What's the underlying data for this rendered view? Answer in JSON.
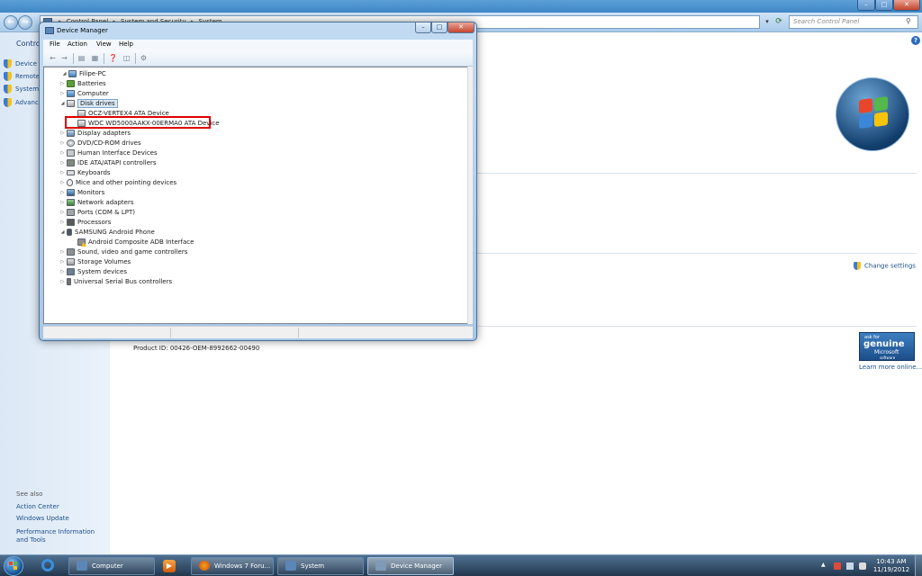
{
  "control_panel": {
    "address": {
      "crumbs": [
        "Control Panel",
        "System and Security",
        "System"
      ],
      "separator": "▸"
    },
    "search_placeholder": "Search Control Panel",
    "sidebar": {
      "header": "Control",
      "items": [
        {
          "label": "Device M"
        },
        {
          "label": "Remote"
        },
        {
          "label": "System"
        },
        {
          "label": "Advanc"
        }
      ],
      "see_also_header": "See also",
      "see_also_links": [
        {
          "label": "Action Center"
        },
        {
          "label": "Windows Update"
        },
        {
          "label": "Performance Information and Tools"
        }
      ]
    },
    "change_settings": "Change settings",
    "product_id": "Product ID: 00426-OEM-8992662-00490",
    "genuine": {
      "ask": "ask for",
      "word": "genuine",
      "microsoft": "Microsoft",
      "software": "software"
    },
    "learn_more": "Learn more online..."
  },
  "device_manager": {
    "title": "Device Manager",
    "menu": [
      "File",
      "Action",
      "View",
      "Help"
    ],
    "tree": [
      {
        "label": "Filipe-PC",
        "level": 0,
        "expanded": true,
        "icon": "computer-icon"
      },
      {
        "label": "Batteries",
        "level": 1,
        "expanded": false,
        "icon": "battery-icon"
      },
      {
        "label": "Computer",
        "level": 1,
        "expanded": false,
        "icon": "computer-icon"
      },
      {
        "label": "Disk drives",
        "level": 1,
        "expanded": true,
        "icon": "disk-drive-icon",
        "selected": true
      },
      {
        "label": "OCZ-VERTEX4 ATA Device",
        "level": 2,
        "icon": "disk-drive-icon"
      },
      {
        "label": "WDC WD5000AAKX-00ERMA0 ATA Device",
        "level": 2,
        "icon": "disk-drive-icon",
        "highlighted": true
      },
      {
        "label": "Display adapters",
        "level": 1,
        "expanded": false,
        "icon": "display-adapter-icon"
      },
      {
        "label": "DVD/CD-ROM drives",
        "level": 1,
        "expanded": false,
        "icon": "dvd-drive-icon"
      },
      {
        "label": "Human Interface Devices",
        "level": 1,
        "expanded": false,
        "icon": "hid-icon"
      },
      {
        "label": "IDE ATA/ATAPI controllers",
        "level": 1,
        "expanded": false,
        "icon": "ide-controller-icon"
      },
      {
        "label": "Keyboards",
        "level": 1,
        "expanded": false,
        "icon": "keyboard-icon"
      },
      {
        "label": "Mice and other pointing devices",
        "level": 1,
        "expanded": false,
        "icon": "mouse-icon"
      },
      {
        "label": "Monitors",
        "level": 1,
        "expanded": false,
        "icon": "monitor-icon"
      },
      {
        "label": "Network adapters",
        "level": 1,
        "expanded": false,
        "icon": "network-adapter-icon"
      },
      {
        "label": "Ports (COM & LPT)",
        "level": 1,
        "expanded": false,
        "icon": "port-icon"
      },
      {
        "label": "Processors",
        "level": 1,
        "expanded": false,
        "icon": "processor-icon"
      },
      {
        "label": "SAMSUNG Android Phone",
        "level": 1,
        "expanded": true,
        "icon": "phone-icon"
      },
      {
        "label": "Android Composite ADB Interface",
        "level": 2,
        "icon": "warning-device-icon"
      },
      {
        "label": "Sound, video and game controllers",
        "level": 1,
        "expanded": false,
        "icon": "sound-icon"
      },
      {
        "label": "Storage Volumes",
        "level": 1,
        "expanded": false,
        "icon": "storage-volume-icon"
      },
      {
        "label": "System devices",
        "level": 1,
        "expanded": false,
        "icon": "system-device-icon"
      },
      {
        "label": "Universal Serial Bus controllers",
        "level": 1,
        "expanded": false,
        "icon": "usb-icon"
      }
    ],
    "highlight_color": "#e00000"
  },
  "taskbar": {
    "buttons": [
      {
        "label": "Computer"
      },
      {
        "label": "Windows 7 Foru..."
      },
      {
        "label": "System"
      },
      {
        "label": "Device Manager",
        "active": true
      }
    ],
    "clock_time": "10:43 AM",
    "clock_date": "11/19/2012"
  }
}
